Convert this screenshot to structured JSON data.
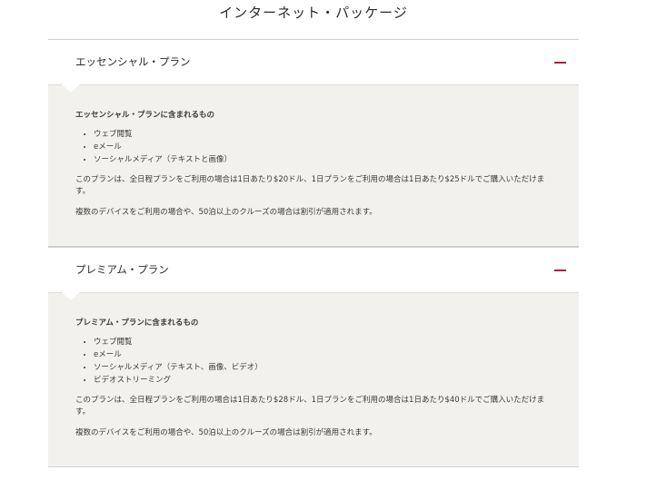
{
  "page": {
    "title": "インターネット・パッケージ"
  },
  "plans": [
    {
      "name": "エッセンシャル・プラン",
      "toggle_symbol": "—",
      "includes_heading": "エッセンシャル・プランに含まれるもの",
      "features": [
        "ウェブ閲覧",
        "eメール",
        "ソーシャルメディア（テキストと画像）"
      ],
      "pricing_text": "このプランは、全日程プランをご利用の場合は1日あたり$20ドル、1日プランをご利用の場合は1日あたり$25ドルでご購入いただけます。",
      "discount_text": "複数のデバイスをご利用の場合や、50泊以上のクルーズの場合は割引が適用されます。"
    },
    {
      "name": "プレミアム・プラン",
      "toggle_symbol": "—",
      "includes_heading": "プレミアム・プランに含まれるもの",
      "features": [
        "ウェブ閲覧",
        "eメール",
        "ソーシャルメディア（テキスト、画像、ビデオ）",
        "ビデオストリーミング"
      ],
      "pricing_text": "このプランは、全日程プランをご利用の場合は1日あたり$28ドル、1日プランをご利用の場合は1日あたり$40ドルでご購入いただけます。",
      "discount_text": "複数のデバイスをご利用の場合や、50泊以上のクルーズの場合は割引が適用されます。"
    }
  ],
  "colors": {
    "accent": "#b0183a",
    "panel_background": "#f2f1ed",
    "divider": "#cfcfcf"
  }
}
